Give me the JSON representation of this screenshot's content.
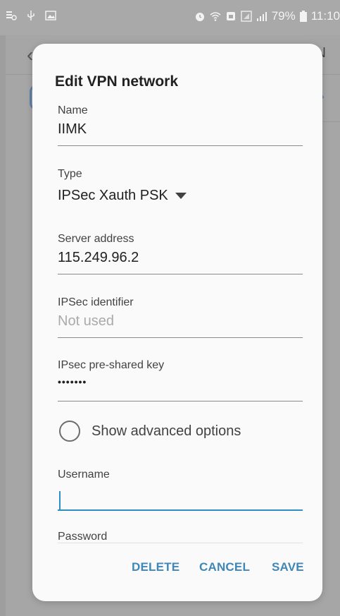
{
  "status_bar": {
    "battery": "79%",
    "time": "11:10"
  },
  "background_app": {
    "header_letter": "N",
    "arrow_glyph": "›"
  },
  "dialog": {
    "title": "Edit VPN network",
    "fields": {
      "name": {
        "label": "Name",
        "value": "IIMK"
      },
      "type": {
        "label": "Type",
        "value": "IPSec Xauth PSK"
      },
      "server_address": {
        "label": "Server address",
        "value": "115.249.96.2"
      },
      "ipsec_identifier": {
        "label": "IPSec identifier",
        "placeholder": "Not used"
      },
      "ipsec_psk": {
        "label": "IPsec pre-shared key",
        "masked_value": "•••••••"
      },
      "username": {
        "label": "Username",
        "value": ""
      },
      "password": {
        "label": "Password"
      }
    },
    "show_advanced": {
      "label": "Show advanced options",
      "checked": false
    },
    "actions": {
      "delete": "DELETE",
      "cancel": "CANCEL",
      "save": "SAVE"
    }
  },
  "colors": {
    "accent": "#3e87b8",
    "focus_underline": "#2d8fc6",
    "dialog_bg": "#fafafa",
    "scrim": "#a6a6a6"
  }
}
